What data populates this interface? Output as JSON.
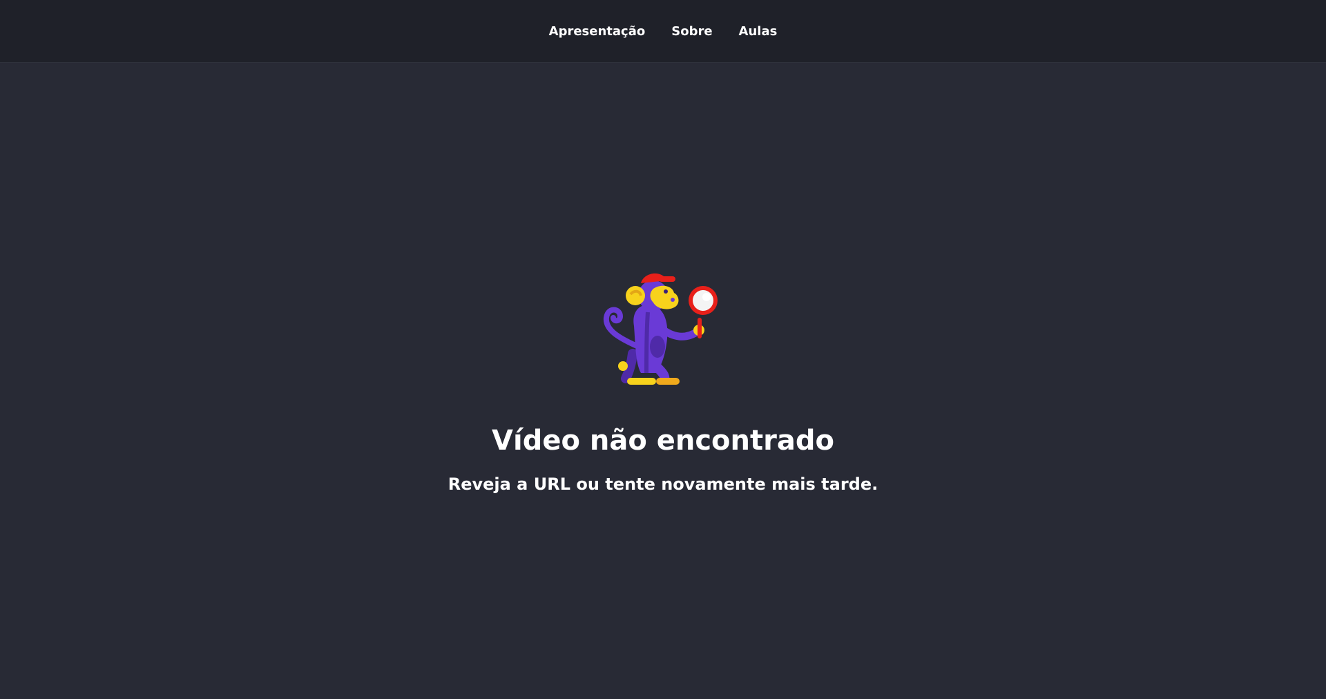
{
  "nav": {
    "items": [
      {
        "label": "Apresentação"
      },
      {
        "label": "Sobre"
      },
      {
        "label": "Aulas"
      }
    ]
  },
  "error": {
    "illustration_icon": "monkey-magnifying-glass-icon",
    "title": "Vídeo não encontrado",
    "message": "Reveja a URL ou tente novamente mais tarde."
  },
  "colors": {
    "background": "#282a35",
    "header_background": "#1f2129",
    "text": "#ffffff",
    "monkey_purple": "#6a3ad6",
    "monkey_face": "#f7d21c",
    "cap_red": "#e8201a"
  }
}
